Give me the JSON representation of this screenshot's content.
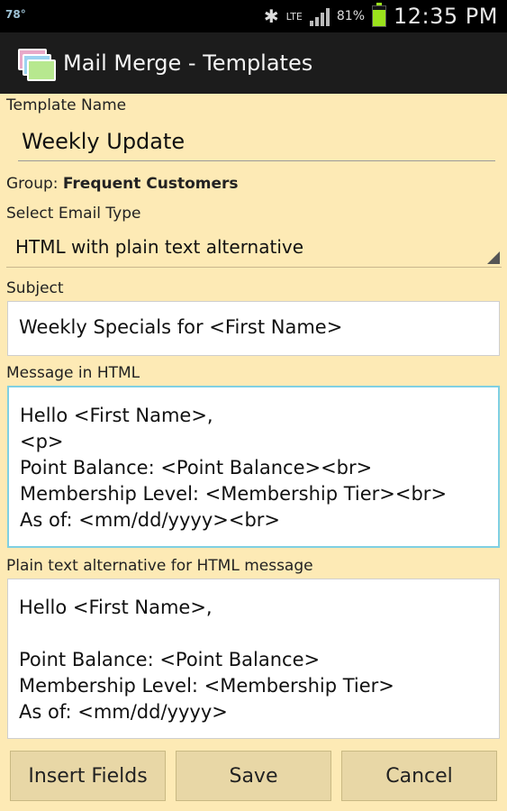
{
  "status_bar": {
    "left_text": "78°",
    "battery_percent": "81%",
    "battery_level": 0.81,
    "time": "12:35 PM",
    "network": "LTE"
  },
  "app": {
    "title": "Mail Merge - Templates"
  },
  "form": {
    "template_name_label": "Template Name",
    "template_name_value": "Weekly Update",
    "group_label": "Group:",
    "group_value": "Frequent Customers",
    "email_type_label": "Select Email Type",
    "email_type_value": "HTML with plain text alternative",
    "subject_label": "Subject",
    "subject_value": "Weekly Specials for <First Name>",
    "html_label": "Message in HTML",
    "html_lines": [
      "Hello <First Name>,",
      "<p>",
      "Point Balance: <Point Balance><br>",
      "Membership Level: <Membership Tier><br>",
      "As of: <mm/dd/yyyy><br>"
    ],
    "plain_label": "Plain text alternative for HTML message",
    "plain_lines": [
      "Hello <First Name>,",
      "",
      "Point Balance: <Point Balance>",
      "Membership Level: <Membership Tier>",
      "As of: <mm/dd/yyyy>"
    ]
  },
  "buttons": {
    "insert_fields": "Insert Fields",
    "save": "Save",
    "cancel": "Cancel"
  },
  "colors": {
    "background": "#fdeab5",
    "title_bar": "#1c1c1c",
    "focus_border": "#7fd0e2",
    "button": "#e8d7a6"
  }
}
